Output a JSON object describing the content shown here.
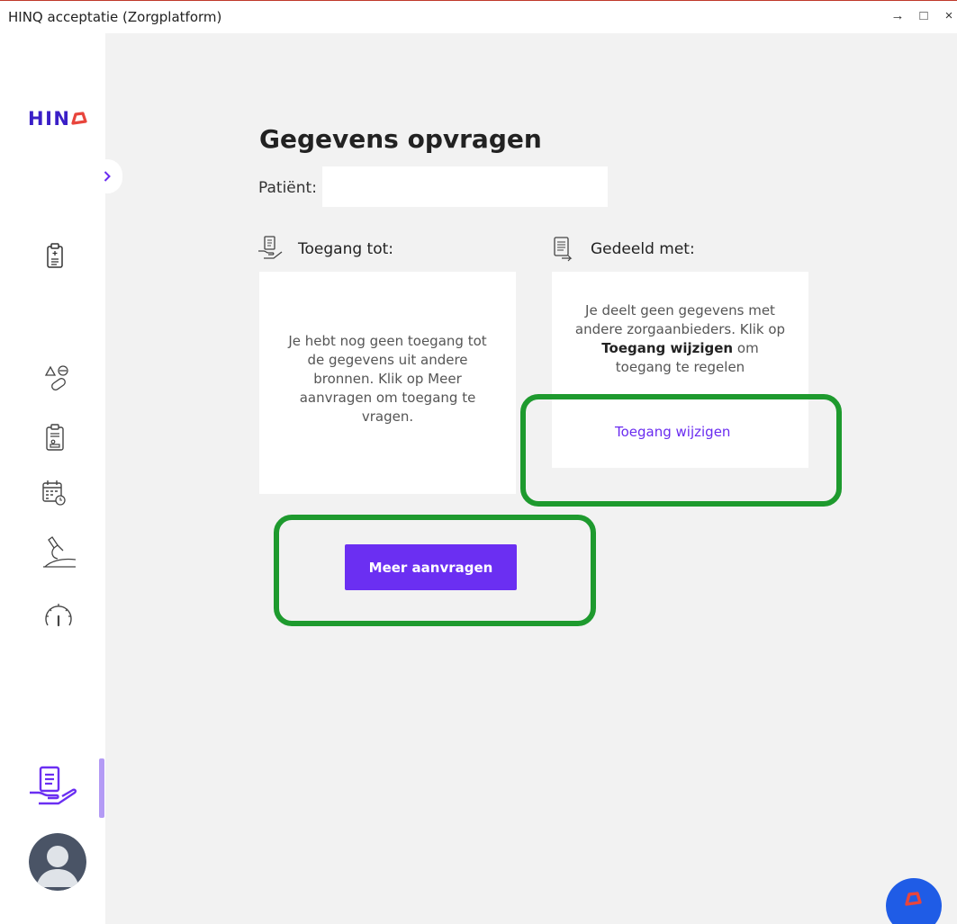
{
  "window": {
    "title": "HINQ acceptatie (Zorgplatform)",
    "controls": [
      "→",
      "□",
      "×"
    ]
  },
  "sidebar": {
    "logo_text": "HIN",
    "nav_icons": [
      "clipboard-icon",
      "medication-icon",
      "patient-record-icon",
      "calendar-icon",
      "lab-icon",
      "dashboard-gauge-icon",
      "data-access-icon"
    ],
    "active_item": "data-access-icon"
  },
  "main": {
    "page_title": "Gegevens opvragen",
    "patient_label": "Patiënt:",
    "patient_value": "",
    "access": {
      "heading": "Toegang tot:",
      "empty_text": "Je hebt nog geen toegang tot de gegevens uit andere bronnen. Klik op Meer aanvragen om toegang te vragen.",
      "button_label": "Meer aanvragen"
    },
    "shared": {
      "heading": "Gedeeld met:",
      "text_before": "Je deelt geen gegevens met andere zorgaanbieders. Klik op ",
      "text_bold": "Toegang wijzigen",
      "text_after": " om toegang te regelen",
      "link_label": "Toegang wijzigen"
    }
  },
  "colors": {
    "accent": "#6b2ff2",
    "logo": "#3a1fc7",
    "logo_mark": "#e8453c",
    "highlight": "#1e9a2e",
    "fab": "#1f5ce6"
  }
}
